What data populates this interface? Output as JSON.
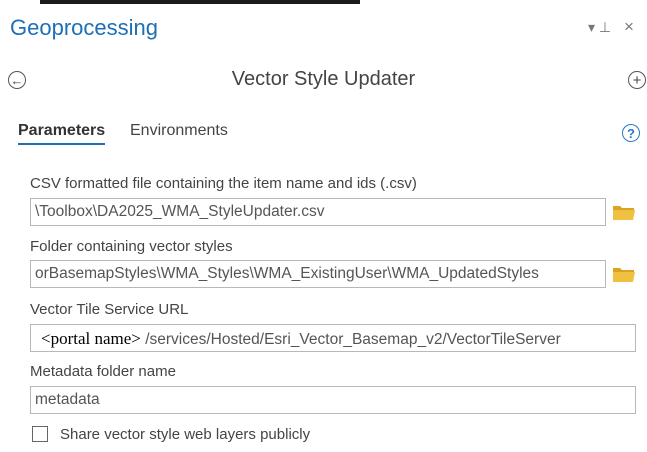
{
  "header": {
    "title": "Geoprocessing",
    "pin_glyph": "▾ ⊥",
    "close_glyph": "×"
  },
  "tool": {
    "back_glyph": "←",
    "title": "Vector Style Updater",
    "add_glyph": "+"
  },
  "tabs": [
    {
      "label": "Parameters",
      "active": true
    },
    {
      "label": "Environments",
      "active": false
    }
  ],
  "help_glyph": "?",
  "params": {
    "csv": {
      "label": "CSV formatted file containing the item name and ids (.csv)",
      "value": "\\Toolbox\\DA2025_WMA_StyleUpdater.csv"
    },
    "folder": {
      "label": "Folder containing vector styles",
      "value": "orBasemapStyles\\WMA_Styles\\WMA_ExistingUser\\WMA_UpdatedStyles"
    },
    "url": {
      "label": "Vector Tile Service URL",
      "portal": "<portal name>",
      "value": "/services/Hosted/Esri_Vector_Basemap_v2/VectorTileServer"
    },
    "metadata": {
      "label": "Metadata folder name",
      "value": "metadata"
    },
    "share": {
      "label": "Share vector style web layers publicly",
      "checked": false
    }
  },
  "colors": {
    "accent": "#1e6fb5",
    "folder_icon": "#f0c040"
  }
}
